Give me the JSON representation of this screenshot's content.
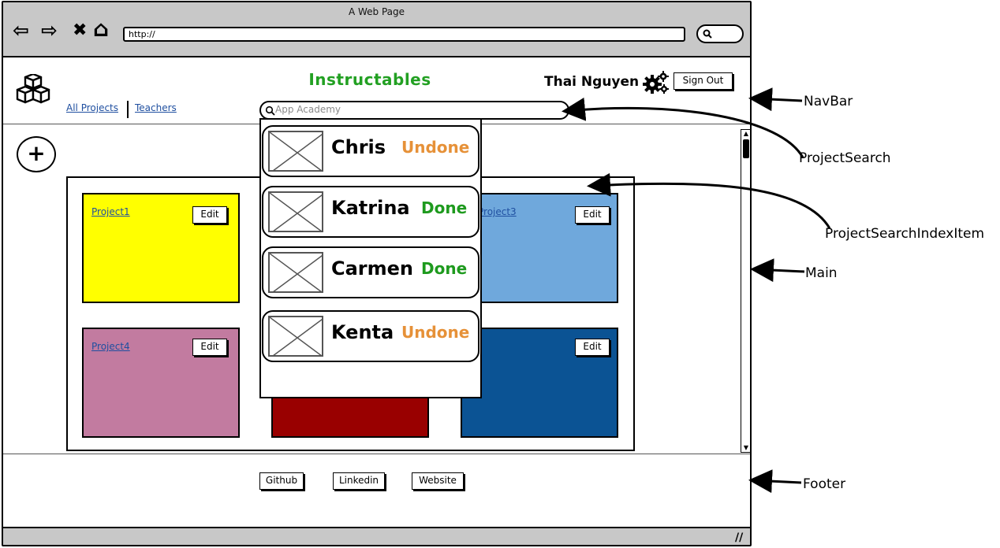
{
  "browser": {
    "title": "A Web Page",
    "url": "http://",
    "back_glyph": "⇦",
    "forward_glyph": "⇨",
    "close_glyph": "✖",
    "home_glyph": "⌂"
  },
  "navbar": {
    "app_title": "Instructables",
    "links": [
      "All Projects",
      "Teachers"
    ],
    "user_name": "Thai Nguyen",
    "sign_out": "Sign Out",
    "search_placeholder": "App Academy"
  },
  "main": {
    "add_label": "+",
    "projects": [
      {
        "label": "Project1",
        "edit": "Edit",
        "color": "#ffff00"
      },
      {
        "label": "",
        "edit": "",
        "color": "#ffffff"
      },
      {
        "label": "Project3",
        "edit": "Edit",
        "color": "#6fa8dc"
      },
      {
        "label": "Project4",
        "edit": "Edit",
        "color": "#c27ba0"
      },
      {
        "label": "",
        "edit": "",
        "color": "#990000"
      },
      {
        "label": "",
        "edit": "Edit",
        "color": "#0b5394"
      }
    ]
  },
  "search_results": [
    {
      "name": "Chris",
      "status": "Undone"
    },
    {
      "name": "Katrina",
      "status": "Done"
    },
    {
      "name": "Carmen",
      "status": "Done"
    },
    {
      "name": "Kenta",
      "status": "Undone"
    }
  ],
  "status_colors": {
    "Done": "#1e9a1e",
    "Undone": "#e69138"
  },
  "footer": {
    "links": [
      "Github",
      "Linkedin",
      "Website"
    ]
  },
  "annotations": {
    "navbar": "NavBar",
    "project_search": "ProjectSearch",
    "project_search_index_item": "ProjectSearchIndexItem",
    "main": "Main",
    "footer": "Footer"
  }
}
